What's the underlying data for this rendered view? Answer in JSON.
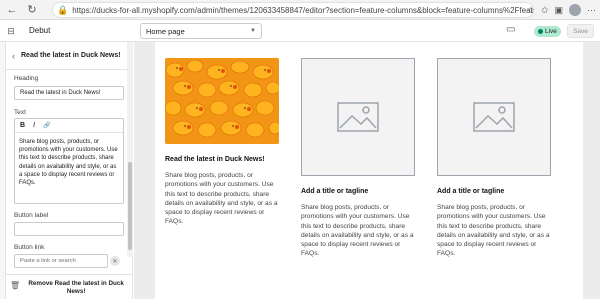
{
  "browser": {
    "url": "https://ducks-for-all.myshopify.com/admin/themes/120633458847/editor?section=feature-columns&block=feature-columns%2Ffeature-c..."
  },
  "editor": {
    "theme_name": "Debut",
    "page_select": "Home page",
    "status": "Live",
    "save_label": "Save"
  },
  "sidebar": {
    "title": "Read the latest in Duck News!",
    "heading_label": "Heading",
    "heading_value": "Read the latest in Duck News!",
    "text_label": "Text",
    "rte_tools": [
      "B",
      "I",
      "🔗"
    ],
    "text_value": "Share blog posts, products, or promotions with your customers. Use this text to describe products, share details on availability and style, or as a space to display recent reviews or FAQs.",
    "button_label_label": "Button label",
    "button_label_value": "",
    "button_link_label": "Button link",
    "button_link_placeholder": "Paste a link or search",
    "remove_label": "Remove Read the latest in Duck News!"
  },
  "preview": {
    "columns": [
      {
        "heading": "Read the latest in Duck News!",
        "text": "Share blog posts, products, or promotions with your customers. Use this text to describe products, share details on availability and style, or as a space to display recent reviews or FAQs."
      },
      {
        "heading": "Add a title or tagline",
        "text": "Share blog posts, products, or promotions with your customers. Use this text to describe products, share details on availability and style, or as a space to display recent reviews or FAQs."
      },
      {
        "heading": "Add a title or tagline",
        "text": "Share blog posts, products, or promotions with your customers. Use this text to describe products, share details on availability and style, or as a space to display recent reviews or FAQs."
      }
    ]
  },
  "colors": {
    "live_badge": "#aee9d1",
    "live_dot": "#007f5f",
    "preview_bg": "#ececec"
  }
}
